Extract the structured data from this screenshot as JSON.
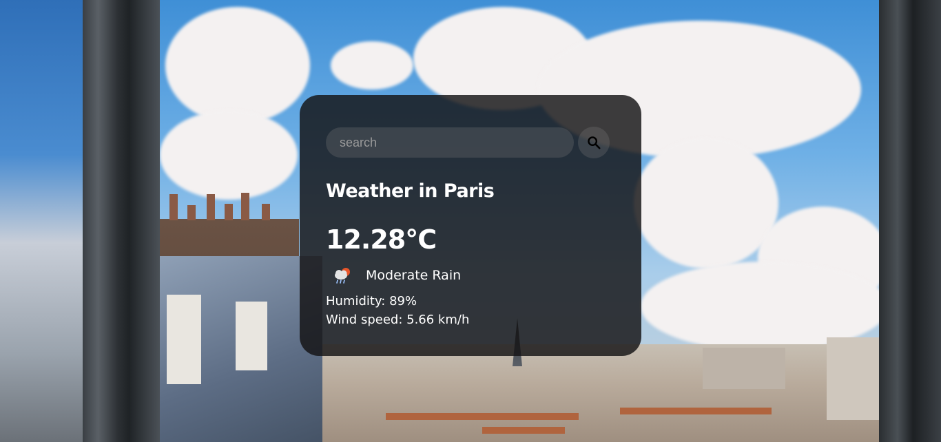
{
  "search": {
    "placeholder": "search",
    "button_icon": "search-icon"
  },
  "weather": {
    "title": "Weather in Paris",
    "temperature": "12.28°C",
    "condition_icon": "cloud-rain-sun-icon",
    "description": "Moderate Rain",
    "humidity": "Humidity: 89%",
    "wind": "Wind speed: 5.66 km/h"
  },
  "colors": {
    "card_background": "#141214",
    "text": "#ffffff",
    "search_background": "#7d7d7d",
    "sun_accent": "#e8562a"
  }
}
